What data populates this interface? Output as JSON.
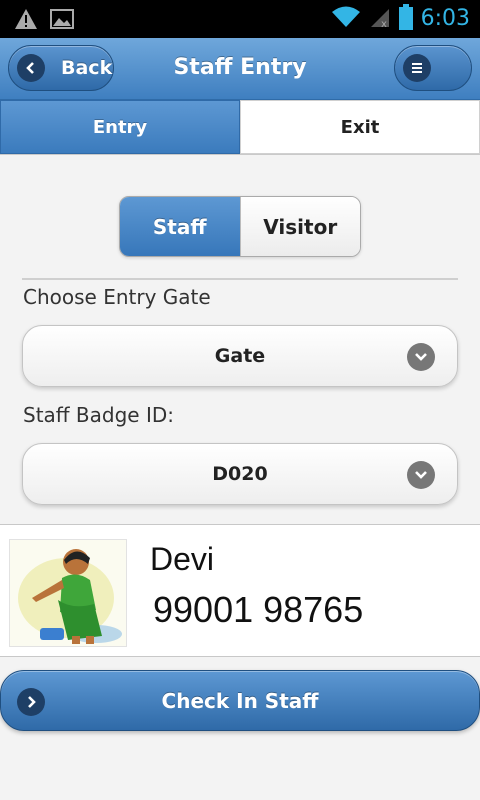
{
  "status_bar": {
    "time": "6:03",
    "icons": [
      "warning-icon",
      "image-icon",
      "wifi-icon",
      "no-signal-icon",
      "battery-icon"
    ]
  },
  "header": {
    "back_label": "Back",
    "title": "Staff Entry",
    "menu_icon": "menu-icon"
  },
  "tabs": [
    {
      "label": "Entry",
      "active": true
    },
    {
      "label": "Exit",
      "active": false
    }
  ],
  "person_type": {
    "options": [
      "Staff",
      "Visitor"
    ],
    "selected": "Staff"
  },
  "entry_gate": {
    "label": "Choose Entry Gate",
    "value": "Gate"
  },
  "badge": {
    "label": "Staff Badge ID:",
    "value": "D020"
  },
  "staff": {
    "name": "Devi",
    "phone": "99001 98765"
  },
  "action": {
    "checkin_label": "Check In Staff"
  },
  "colors": {
    "accent": "#3f7fc0",
    "status_icons": "#33b5e5"
  }
}
